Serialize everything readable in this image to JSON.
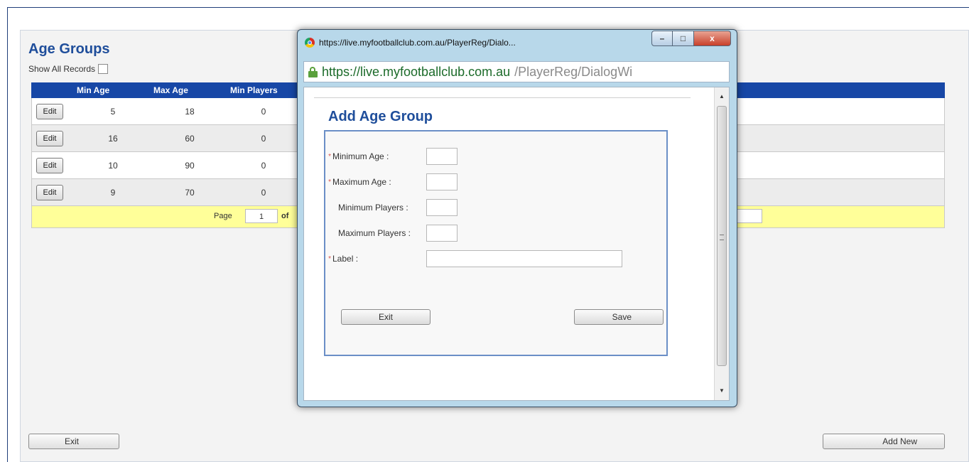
{
  "page": {
    "title": "Age Groups",
    "show_all_label": "Show All Records",
    "columns": [
      "",
      "Min Age",
      "Max Age",
      "Min Players"
    ],
    "edit_label": "Edit",
    "rows": [
      {
        "min_age": "5",
        "max_age": "18",
        "min_players": "0"
      },
      {
        "min_age": "16",
        "max_age": "60",
        "min_players": "0"
      },
      {
        "min_age": "10",
        "max_age": "90",
        "min_players": "0"
      },
      {
        "min_age": "9",
        "max_age": "70",
        "min_players": "0"
      }
    ],
    "pager": {
      "page_label": "Page",
      "page_value": "1",
      "of_label": "of"
    },
    "exit_label": "Exit",
    "add_new_label": "Add New"
  },
  "popup": {
    "window_title": "https://live.myfootballclub.com.au/PlayerReg/Dialo...",
    "url_host": "https://live.myfootballclub.com.au",
    "url_path": "/PlayerReg/DialogWi",
    "dialog_title": "Add Age Group",
    "required_marker": "*",
    "fields": {
      "min_age": "Minimum Age :",
      "max_age": "Maximum Age :",
      "min_players": "Minimum Players :",
      "max_players": "Maximum Players :",
      "label": "Label :"
    },
    "exit_label": "Exit",
    "save_label": "Save",
    "close_glyph": "x"
  },
  "colors": {
    "header_blue": "#1747a6",
    "title_blue": "#1f4e9b",
    "pager_yellow": "#ffff99"
  }
}
